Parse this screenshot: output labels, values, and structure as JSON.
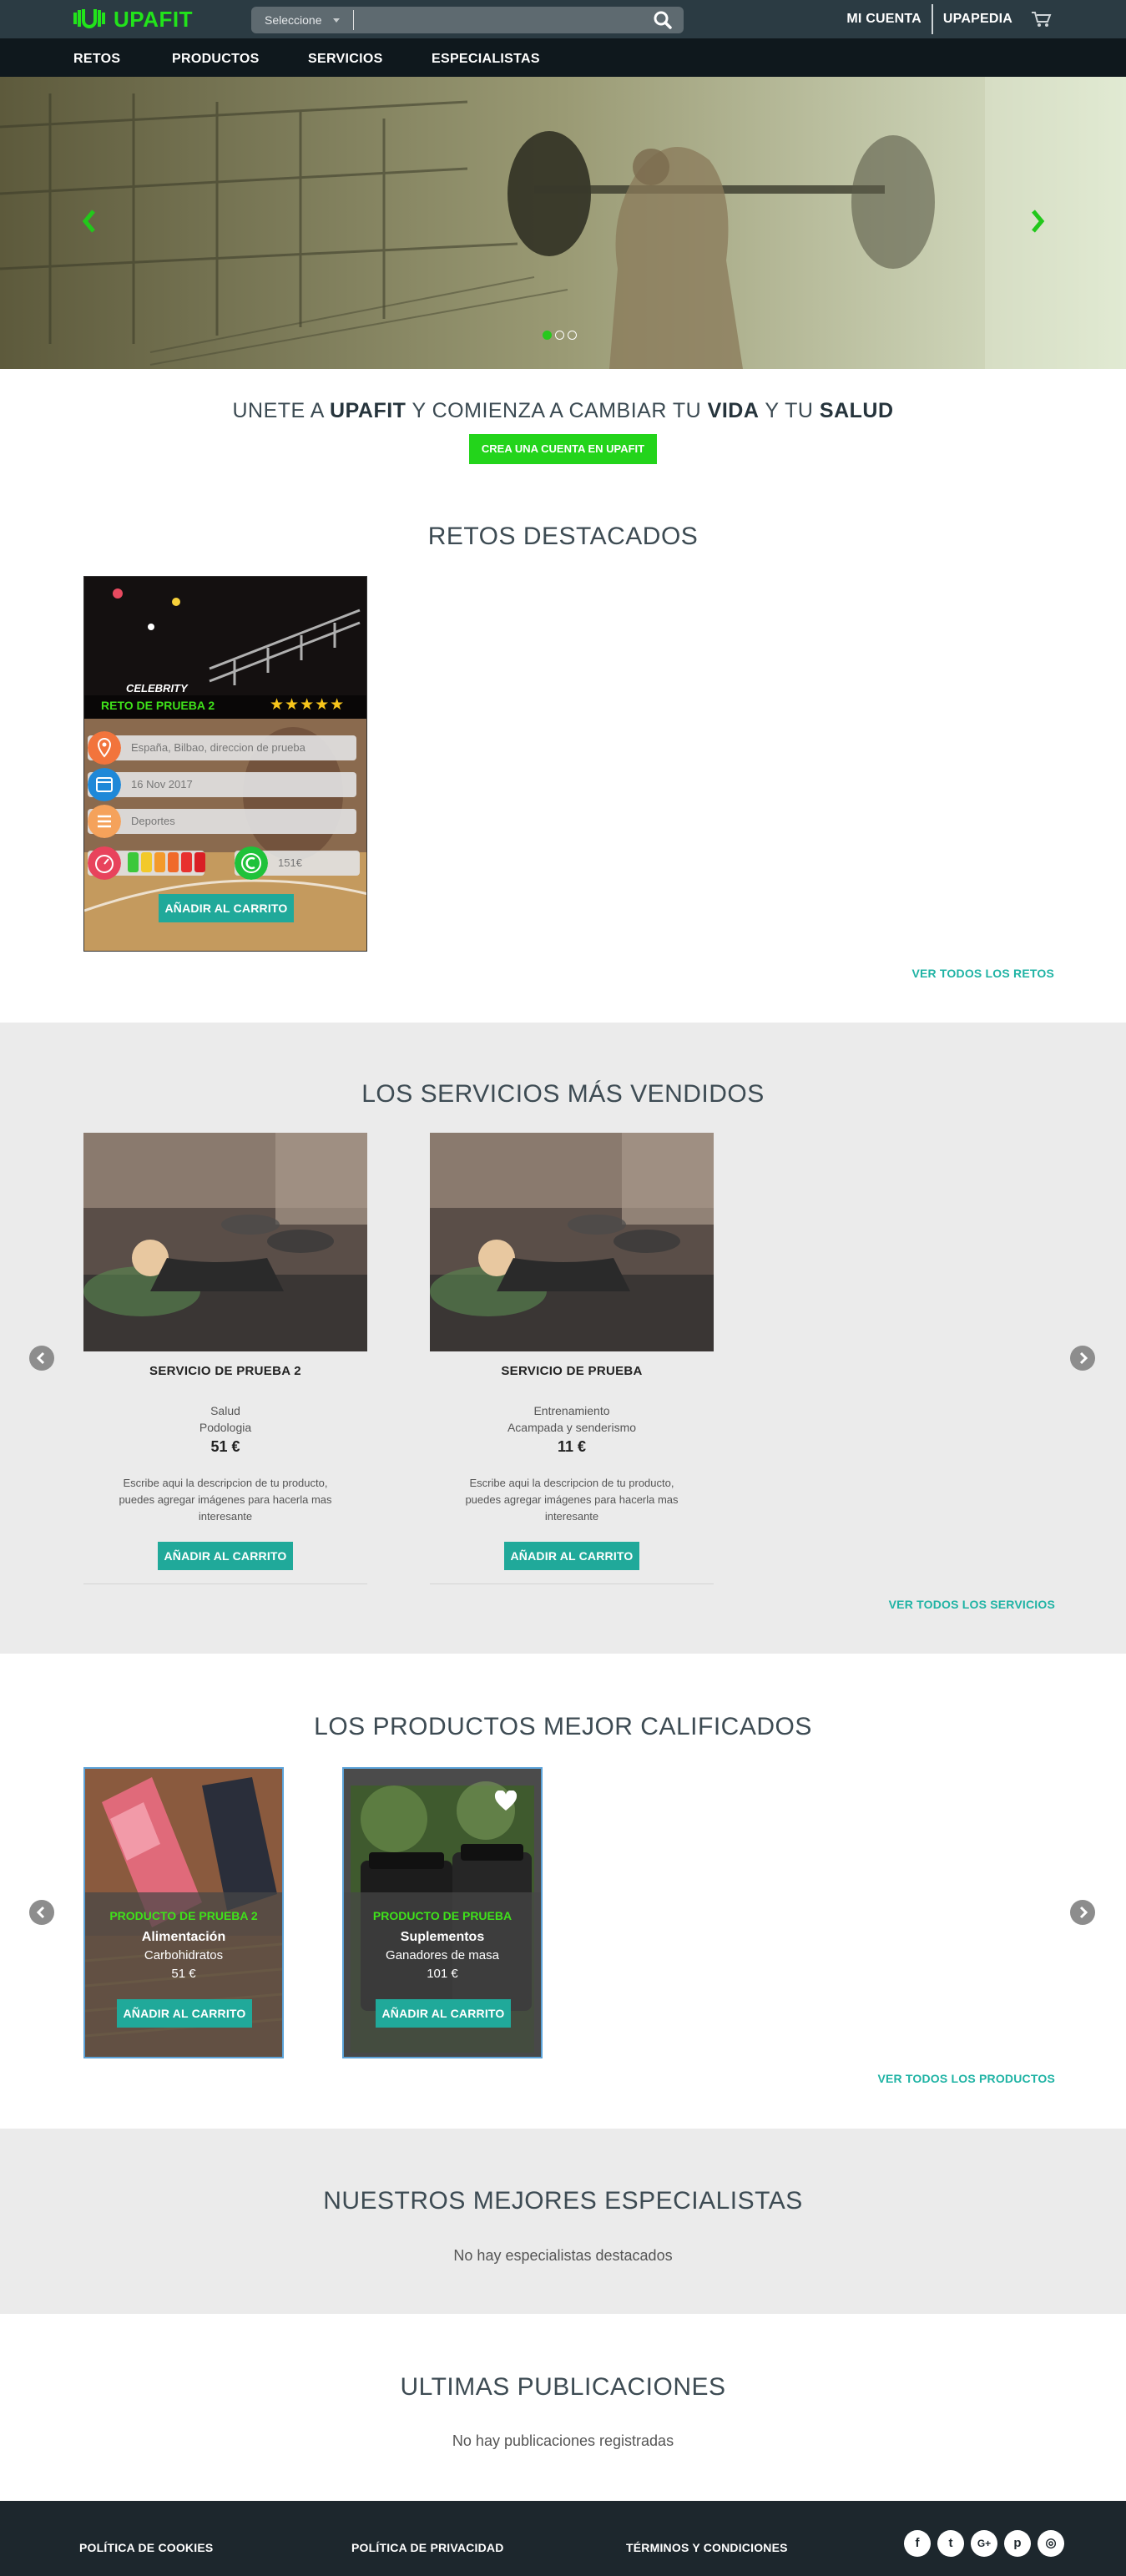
{
  "header": {
    "logo_text": "UPAFIT",
    "search": {
      "select_label": "Seleccione",
      "placeholder": ""
    },
    "links": [
      "MI CUENTA",
      "UPAPEDIA"
    ]
  },
  "nav": {
    "items": [
      "RETOS",
      "PRODUCTOS",
      "SERVICIOS",
      "ESPECIALISTAS"
    ]
  },
  "hero": {
    "active_slide": 1,
    "slide_count": 3
  },
  "join": {
    "parts": [
      "UNETE A ",
      "UPAFIT",
      " Y COMIENZA A CAMBIAR TU ",
      "VIDA",
      " Y TU ",
      "SALUD"
    ],
    "button": "CREA UNA CUENTA EN UPAFIT"
  },
  "retos": {
    "title": "RETOS DESTACADOS",
    "card": {
      "badge": "CELEBRITY",
      "name": "RETO DE PRUEBA 2",
      "stars": "★★★★★",
      "location": "España, Bilbao, direccion de prueba",
      "date": "16 Nov 2017",
      "category": "Deportes",
      "price": "151€",
      "button": "AÑADIR AL CARRITO"
    },
    "see_all": "VER TODOS LOS RETOS"
  },
  "servicios": {
    "title": "LOS SERVICIOS MÁS VENDIDOS",
    "items": [
      {
        "title": "SERVICIO DE PRUEBA 2",
        "line1": "Salud",
        "line2": "Podologia",
        "price": "51 €",
        "desc": "Escribe aqui la descripcion de tu producto, puedes agregar imágenes para hacerla mas interesante",
        "button": "AÑADIR AL CARRITO"
      },
      {
        "title": "SERVICIO DE PRUEBA",
        "line1": "Entrenamiento",
        "line2": "Acampada y senderismo",
        "price": "11 €",
        "desc": "Escribe aqui la descripcion de tu producto, puedes agregar imágenes para hacerla mas interesante",
        "button": "AÑADIR AL CARRITO"
      }
    ],
    "see_all": "VER TODOS LOS SERVICIOS"
  },
  "productos": {
    "title": "LOS PRODUCTOS MEJOR CALIFICADOS",
    "items": [
      {
        "name": "PRODUCTO DE PRUEBA 2",
        "category": "Alimentación",
        "sub": "Carbohidratos",
        "price": "51 €",
        "button": "AÑADIR AL CARRITO"
      },
      {
        "name": "PRODUCTO DE PRUEBA",
        "category": "Suplementos",
        "sub": "Ganadores de masa",
        "price": "101 €",
        "button": "AÑADIR AL CARRITO"
      }
    ],
    "see_all": "VER TODOS LOS PRODUCTOS"
  },
  "especialistas": {
    "title": "NUESTROS MEJORES ESPECIALISTAS",
    "empty": "No hay especialistas destacados"
  },
  "publicaciones": {
    "title": "ULTIMAS PUBLICACIONES",
    "empty": "No hay publicaciones registradas"
  },
  "footer": {
    "links": [
      "POLÍTICA DE COOKIES",
      "POLÍTICA DE PRIVACIDAD",
      "TÉRMINOS Y CONDICIONES"
    ],
    "social": [
      "f",
      "t",
      "G+",
      "p",
      "◎"
    ]
  },
  "colors": {
    "brand_green": "#23d41b",
    "teal": "#20a99a",
    "topbar": "#2b3b43",
    "navbar": "#0f181d"
  }
}
